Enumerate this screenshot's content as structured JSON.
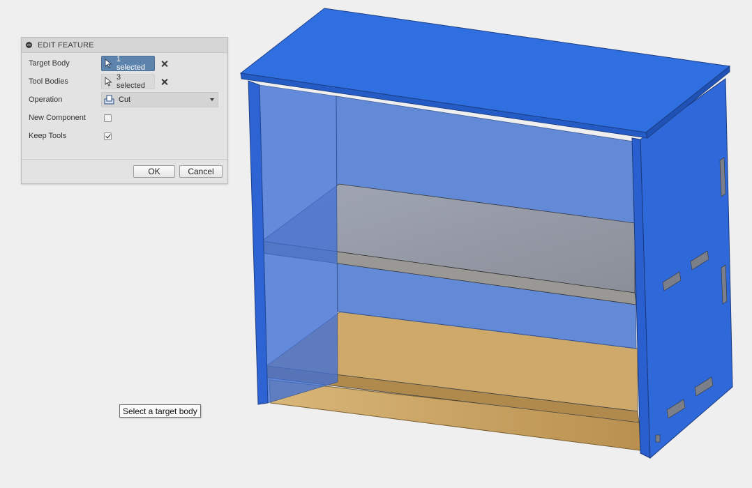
{
  "panel": {
    "title": "EDIT FEATURE",
    "rows": {
      "target_body": {
        "label": "Target Body",
        "value": "1 selected"
      },
      "tool_bodies": {
        "label": "Tool Bodies",
        "value": "3 selected"
      },
      "operation": {
        "label": "Operation",
        "value": "Cut"
      },
      "new_component": {
        "label": "New Component",
        "checked": false
      },
      "keep_tools": {
        "label": "Keep Tools",
        "checked": true
      }
    },
    "ok_label": "OK",
    "cancel_label": "Cancel"
  },
  "tooltip": {
    "text": "Select a target body"
  },
  "colors": {
    "selected_blue": "#5d84ad",
    "body_highlight_blue": "#2f6fd8",
    "wood_light": "#c8a56a",
    "canvas_bg": "#efefef"
  },
  "icons": [
    "collapse-icon",
    "cursor-icon",
    "clear-icon",
    "cut-operation-icon",
    "dropdown-caret-icon",
    "checkbox-icon"
  ]
}
